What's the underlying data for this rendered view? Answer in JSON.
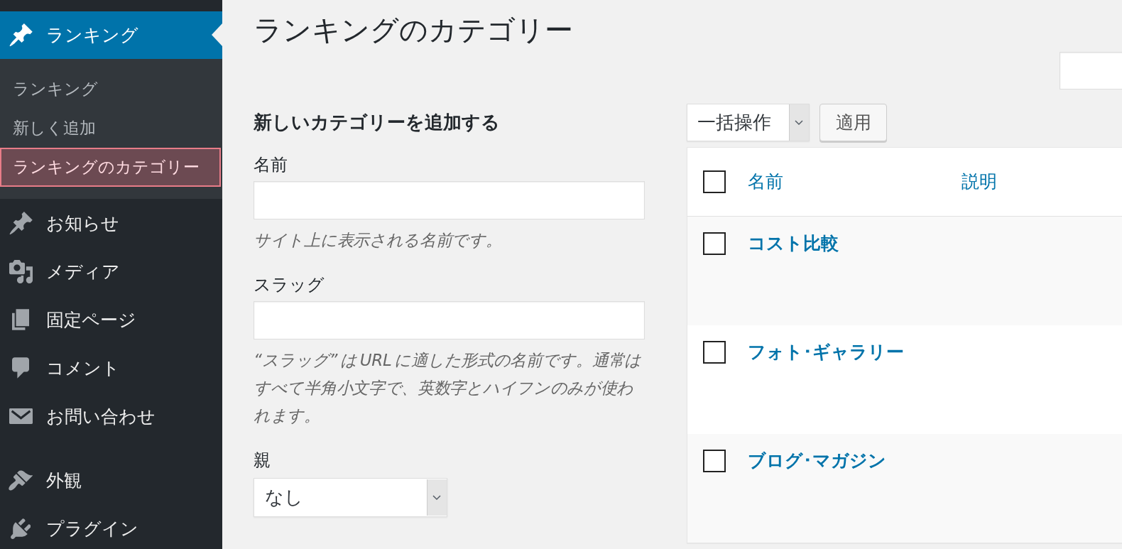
{
  "sidebar": {
    "sections": [
      {
        "items": [
          {
            "kind": "pin",
            "label": "ランキング",
            "selected": true,
            "submenu": [
              {
                "label": "ランキング",
                "selected": false
              },
              {
                "label": "新しく追加",
                "selected": false
              },
              {
                "label": "ランキングのカテゴリー",
                "selected": true
              }
            ]
          },
          {
            "kind": "pin",
            "label": "お知らせ",
            "selected": false
          },
          {
            "kind": "media",
            "label": "メディア",
            "selected": false
          },
          {
            "kind": "pages",
            "label": "固定ページ",
            "selected": false
          },
          {
            "kind": "comments",
            "label": "コメント",
            "selected": false
          },
          {
            "kind": "mail",
            "label": "お問い合わせ",
            "selected": false
          }
        ]
      },
      {
        "items": [
          {
            "kind": "brush",
            "label": "外観",
            "selected": false
          },
          {
            "kind": "plugin",
            "label": "プラグイン",
            "selected": false
          }
        ]
      }
    ]
  },
  "page_title": "ランキングのカテゴリー",
  "add_form": {
    "heading": "新しいカテゴリーを追加する",
    "fields": [
      {
        "kind": "text",
        "label": "名前",
        "hint": "サイト上に表示される名前です。"
      },
      {
        "kind": "text",
        "label": "スラッグ",
        "hint": "“スラッグ” は URL に適した形式の名前です。通常はすべて半角小文字で、英数字とハイフンのみが使われます。"
      },
      {
        "kind": "select",
        "label": "親",
        "value": "なし"
      }
    ]
  },
  "table": {
    "bulk_actions": {
      "value": "一括操作"
    },
    "apply_button": "適用",
    "select_all": {
      "checked": false
    },
    "columns": [
      "名前",
      "説明"
    ],
    "rows": [
      {
        "name": "コスト比較",
        "checked": false
      },
      {
        "name": "フォト･ギャラリー",
        "checked": false
      },
      {
        "name": "ブログ･マガジン",
        "checked": false
      }
    ]
  }
}
